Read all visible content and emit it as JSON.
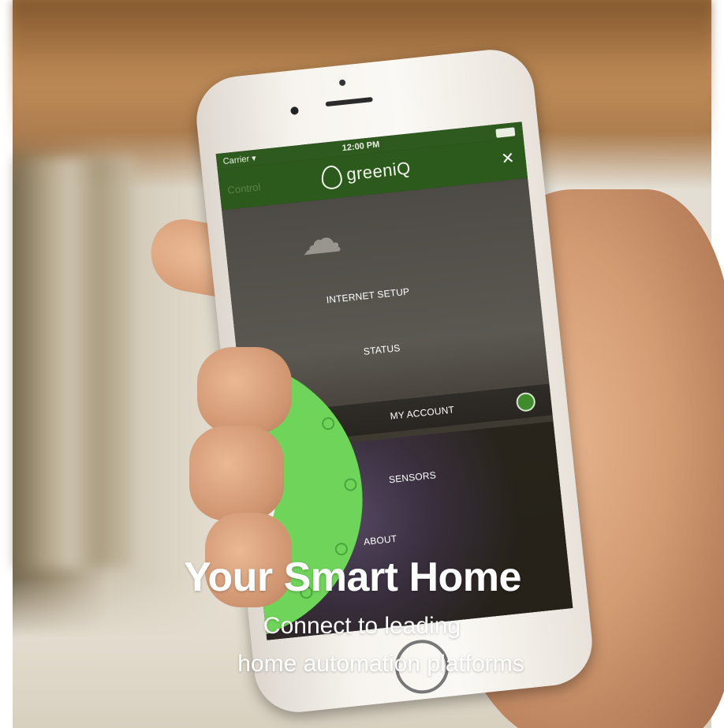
{
  "status_bar": {
    "carrier": "Carrier ▾",
    "time": "12:00 PM"
  },
  "app": {
    "logo": "greeniQ",
    "control_link": "Control",
    "close_glyph": "✕"
  },
  "menu": {
    "items": [
      "INTERNET SETUP",
      "STATUS",
      "MY ACCOUNT",
      "SENSORS",
      "ABOUT"
    ]
  },
  "caption": {
    "title": "Your Smart Home",
    "line1": "Connect to leading",
    "line2": "home automation platforms"
  },
  "colors": {
    "app_green": "#2c5a1c",
    "ring_green": "#6fd45a"
  }
}
